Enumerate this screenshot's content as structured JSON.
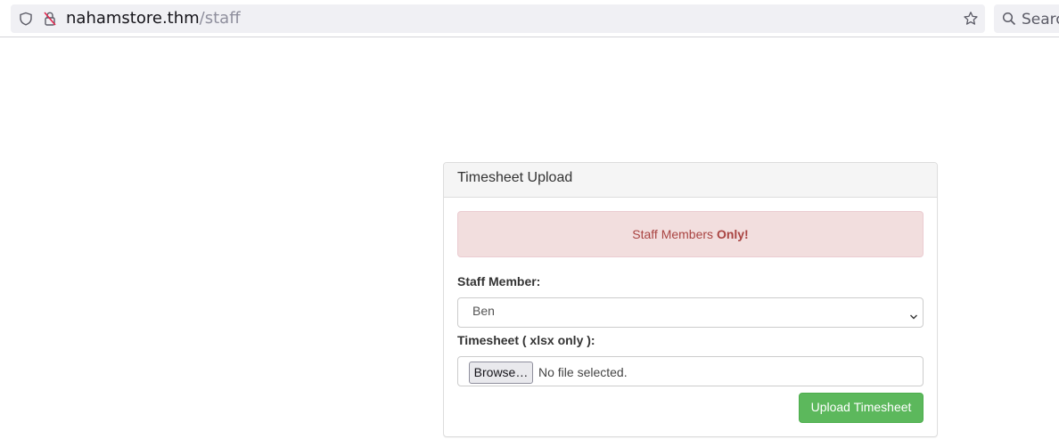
{
  "browser": {
    "url_host": "nahamstore.thm",
    "url_path": "/staff",
    "search_placeholder": "Search"
  },
  "panel": {
    "title": "Timesheet Upload",
    "alert": {
      "text": "Staff Members ",
      "bold": "Only!"
    },
    "staff_label": "Staff Member:",
    "staff_selected": "Ben",
    "timesheet_label": "Timesheet ( xlsx only ):",
    "browse_label": "Browse…",
    "file_status": "No file selected.",
    "upload_label": "Upload Timesheet"
  },
  "colors": {
    "alert_bg": "#f2dede",
    "alert_text": "#a94442",
    "upload_button": "#5cb85c"
  }
}
